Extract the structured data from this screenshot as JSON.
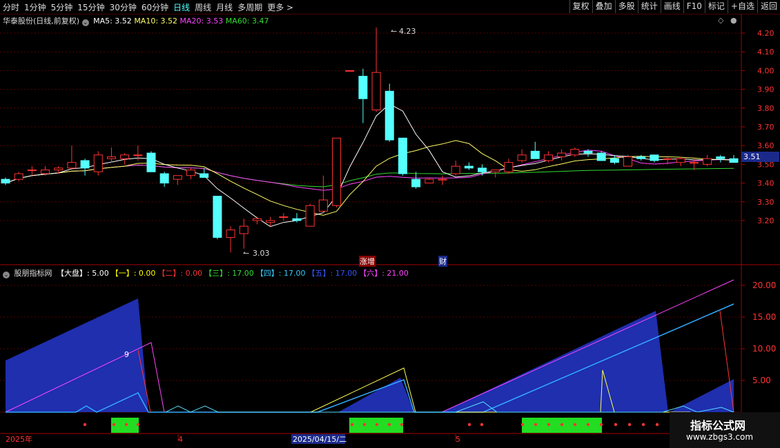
{
  "toolbar": {
    "periods": [
      "分时",
      "1分钟",
      "5分钟",
      "15分钟",
      "30分钟",
      "60分钟",
      "日线",
      "周线",
      "月线",
      "多周期",
      "更多 >"
    ],
    "active": "日线",
    "right": [
      "复权",
      "叠加",
      "多股",
      "统计",
      "画线",
      "F10",
      "标记",
      "+自选",
      "返回"
    ]
  },
  "header": {
    "stock": "华泰股份(日线,前复权)",
    "ma5": "MA5: 3.52",
    "ma10": "MA10: 3.52",
    "ma20": "MA20: 3.53",
    "ma60": "MA60: 3.47"
  },
  "price_axis": [
    "4.20",
    "4.10",
    "4.00",
    "3.90",
    "3.80",
    "3.70",
    "3.60",
    "3.50",
    "3.40",
    "3.30",
    "3.20"
  ],
  "current_price": "3.51",
  "annotations": {
    "high": "4.23",
    "low": "3.03",
    "tag1": "涨",
    "tag2": "增",
    "tag3": "财"
  },
  "indicator": {
    "name": "股朋指标网",
    "items": [
      {
        "label": "【大盘】",
        "value": ": 5.00",
        "color": "#ffffff"
      },
      {
        "label": "【一】",
        "value": ": 0.00",
        "color": "#ffff00"
      },
      {
        "label": "【二】",
        "value": ": 0.00",
        "color": "#ff3333"
      },
      {
        "label": "【三】",
        "value": ": 17.00",
        "color": "#33dd33"
      },
      {
        "label": "【四】",
        "value": ": 17.00",
        "color": "#33ccff"
      },
      {
        "label": "【五】",
        "value": ": 17.00",
        "color": "#3355ff"
      },
      {
        "label": "【六】",
        "value": ": 21.00",
        "color": "#ff44ff"
      }
    ],
    "axis": [
      "20.00",
      "15.00",
      "10.00",
      "5.00"
    ],
    "marker": "9"
  },
  "date_axis": {
    "d1": "2025年",
    "d2": "4",
    "d3": "2025/04/15/二",
    "d4": "5"
  },
  "watermark": {
    "title": "指标公式网",
    "url": "www.zbgs3.com"
  },
  "colors": {
    "up": "#ff3333",
    "down": "#55ffff",
    "ma5": "#ffffff",
    "ma10": "#ffff66",
    "ma20": "#ff44ff",
    "ma60": "#33dd33"
  },
  "chart_data": {
    "type": "candlestick",
    "ohlc": [
      [
        3.42,
        3.43,
        3.39,
        3.4
      ],
      [
        3.42,
        3.46,
        3.41,
        3.45
      ],
      [
        3.47,
        3.49,
        3.44,
        3.47
      ],
      [
        3.45,
        3.49,
        3.44,
        3.47
      ],
      [
        3.47,
        3.49,
        3.45,
        3.48
      ],
      [
        3.48,
        3.6,
        3.47,
        3.51
      ],
      [
        3.52,
        3.53,
        3.44,
        3.48
      ],
      [
        3.46,
        3.57,
        3.44,
        3.55
      ],
      [
        3.53,
        3.59,
        3.51,
        3.54
      ],
      [
        3.53,
        3.56,
        3.5,
        3.55
      ],
      [
        3.55,
        3.6,
        3.52,
        3.55
      ],
      [
        3.56,
        3.57,
        3.46,
        3.46
      ],
      [
        3.45,
        3.46,
        3.38,
        3.4
      ],
      [
        3.42,
        3.44,
        3.39,
        3.44
      ],
      [
        3.44,
        3.48,
        3.42,
        3.47
      ],
      [
        3.45,
        3.48,
        3.44,
        3.43
      ],
      [
        3.33,
        3.33,
        3.1,
        3.11
      ],
      [
        3.11,
        3.17,
        3.03,
        3.15
      ],
      [
        3.13,
        3.21,
        3.05,
        3.17
      ],
      [
        3.2,
        3.22,
        3.18,
        3.21
      ],
      [
        3.19,
        3.22,
        3.17,
        3.2
      ],
      [
        3.22,
        3.24,
        3.2,
        3.22
      ],
      [
        3.21,
        3.24,
        3.19,
        3.2
      ],
      [
        3.17,
        3.29,
        3.17,
        3.28
      ],
      [
        3.25,
        3.44,
        3.24,
        3.31
      ],
      [
        3.28,
        3.64,
        3.27,
        3.64
      ],
      [
        4.0,
        4.0,
        4.0,
        4.0
      ],
      [
        3.97,
        4.01,
        3.72,
        3.85
      ],
      [
        3.79,
        4.23,
        3.78,
        3.99
      ],
      [
        3.89,
        3.93,
        3.62,
        3.63
      ],
      [
        3.64,
        3.64,
        3.44,
        3.45
      ],
      [
        3.42,
        3.46,
        3.37,
        3.38
      ],
      [
        3.4,
        3.43,
        3.4,
        3.42
      ],
      [
        3.42,
        3.44,
        3.39,
        3.42
      ],
      [
        3.45,
        3.52,
        3.44,
        3.49
      ],
      [
        3.49,
        3.51,
        3.47,
        3.48
      ],
      [
        3.48,
        3.5,
        3.44,
        3.46
      ],
      [
        3.46,
        3.47,
        3.43,
        3.47
      ],
      [
        3.46,
        3.53,
        3.45,
        3.51
      ],
      [
        3.52,
        3.58,
        3.51,
        3.55
      ],
      [
        3.57,
        3.62,
        3.53,
        3.53
      ],
      [
        3.52,
        3.57,
        3.51,
        3.55
      ],
      [
        3.54,
        3.58,
        3.52,
        3.56
      ],
      [
        3.55,
        3.59,
        3.54,
        3.58
      ],
      [
        3.57,
        3.58,
        3.54,
        3.56
      ],
      [
        3.56,
        3.57,
        3.52,
        3.52
      ],
      [
        3.53,
        3.55,
        3.5,
        3.51
      ],
      [
        3.49,
        3.55,
        3.49,
        3.54
      ],
      [
        3.54,
        3.55,
        3.52,
        3.53
      ],
      [
        3.55,
        3.55,
        3.51,
        3.52
      ],
      [
        3.53,
        3.54,
        3.5,
        3.53
      ],
      [
        3.51,
        3.54,
        3.49,
        3.53
      ],
      [
        3.51,
        3.53,
        3.47,
        3.51
      ],
      [
        3.5,
        3.55,
        3.49,
        3.53
      ],
      [
        3.54,
        3.55,
        3.51,
        3.53
      ],
      [
        3.53,
        3.55,
        3.51,
        3.51
      ]
    ],
    "ylim": [
      3.03,
      4.23
    ]
  }
}
